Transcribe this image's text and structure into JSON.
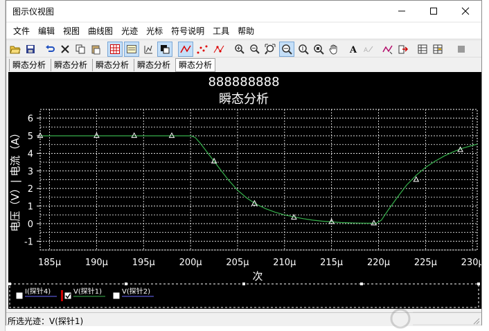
{
  "window": {
    "title": "图示仪视图",
    "controls": [
      "minimize-icon",
      "maximize-icon",
      "close-icon"
    ]
  },
  "menu": {
    "items": [
      "文件",
      "编辑",
      "视图",
      "曲线图",
      "光迹",
      "光标",
      "符号说明",
      "工具",
      "帮助"
    ]
  },
  "toolbar": {
    "icons": [
      "open-folder-icon",
      "save-icon",
      "undo-icon",
      "delete-icon",
      "copy-icon",
      "paste-icon",
      "grid-icon",
      "legend-icon",
      "cursor-pair-icon",
      "black-background-icon",
      "line-trace-icon",
      "dots-icon",
      "line-dots-icon",
      "zoom-in-icon",
      "zoom-out-icon",
      "zoom-fit-icon",
      "zoom-x-icon",
      "zoom-y-icon",
      "zoom-xy-icon",
      "pan-hand-icon",
      "text-icon",
      "text-disabled-icon",
      "peak-marker-icon",
      "export-icon",
      "import-icon",
      "table-icon",
      "stop-icon"
    ]
  },
  "tabs": {
    "items": [
      "瞬态分析",
      "瞬态分析",
      "瞬态分析",
      "瞬态分析",
      "瞬态分析"
    ],
    "active_index": 4
  },
  "plot": {
    "background": "#000000",
    "trace_color": "#37b24d",
    "grid_color": "#ffffff",
    "selected_trace_marker": "#cc0000"
  },
  "chart_data": {
    "type": "line",
    "title": "888888888",
    "subtitle": "瞬态分析",
    "xlabel": "次",
    "ylabel": "电压（V）| 电流（A）",
    "xlim": [
      184,
      230.5
    ],
    "ylim": [
      -1.5,
      6.5
    ],
    "x_ticks": [
      185,
      190,
      195,
      200,
      205,
      210,
      215,
      220,
      225,
      230
    ],
    "x_tick_labels": [
      "185µ",
      "190µ",
      "195µ",
      "200µ",
      "205µ",
      "210µ",
      "215µ",
      "220µ",
      "225µ",
      "230µ"
    ],
    "y_ticks": [
      6,
      5,
      4,
      3,
      2,
      1,
      0,
      -1
    ],
    "y_tick_labels": [
      "6",
      "5",
      "4",
      "3",
      "2",
      "1",
      "0",
      "-1"
    ],
    "grid": true,
    "series": [
      {
        "name": "V(探针1)",
        "x": [
          184,
          186,
          188,
          190,
          192,
          194,
          196,
          198,
          200,
          200.5,
          201,
          202,
          203,
          204,
          205,
          206,
          207,
          208,
          209,
          210,
          211,
          212,
          213,
          214,
          215,
          216,
          217,
          218,
          219,
          219.8,
          220.3,
          221,
          222,
          223,
          224,
          225,
          226,
          227,
          228,
          229,
          230,
          230.5
        ],
        "y": [
          5.0,
          5.0,
          5.0,
          5.0,
          5.0,
          5.0,
          5.0,
          5.0,
          5.0,
          4.9,
          4.6,
          3.9,
          3.2,
          2.5,
          1.9,
          1.45,
          1.1,
          0.85,
          0.65,
          0.5,
          0.38,
          0.28,
          0.2,
          0.14,
          0.1,
          0.06,
          0.04,
          0.03,
          0.02,
          0.03,
          0.2,
          0.75,
          1.5,
          2.2,
          2.75,
          3.2,
          3.55,
          3.85,
          4.1,
          4.3,
          4.45,
          4.52
        ],
        "markers_x": [
          184,
          190,
          194,
          198,
          202.5,
          206.8,
          211,
          215,
          219.5,
          224,
          228.7
        ],
        "markers_y": [
          5.0,
          5.0,
          5.0,
          5.0,
          3.55,
          1.15,
          0.35,
          0.1,
          0.02,
          2.5,
          4.2
        ]
      }
    ],
    "legend": {
      "placement": "bottom",
      "entries": [
        {
          "label": "I(探针4)",
          "checked": false
        },
        {
          "label": "V(探针1)",
          "checked": true
        },
        {
          "label": "V(探针2)",
          "checked": false
        }
      ]
    }
  },
  "status": {
    "text": "所选光迹：V(探针1)"
  }
}
